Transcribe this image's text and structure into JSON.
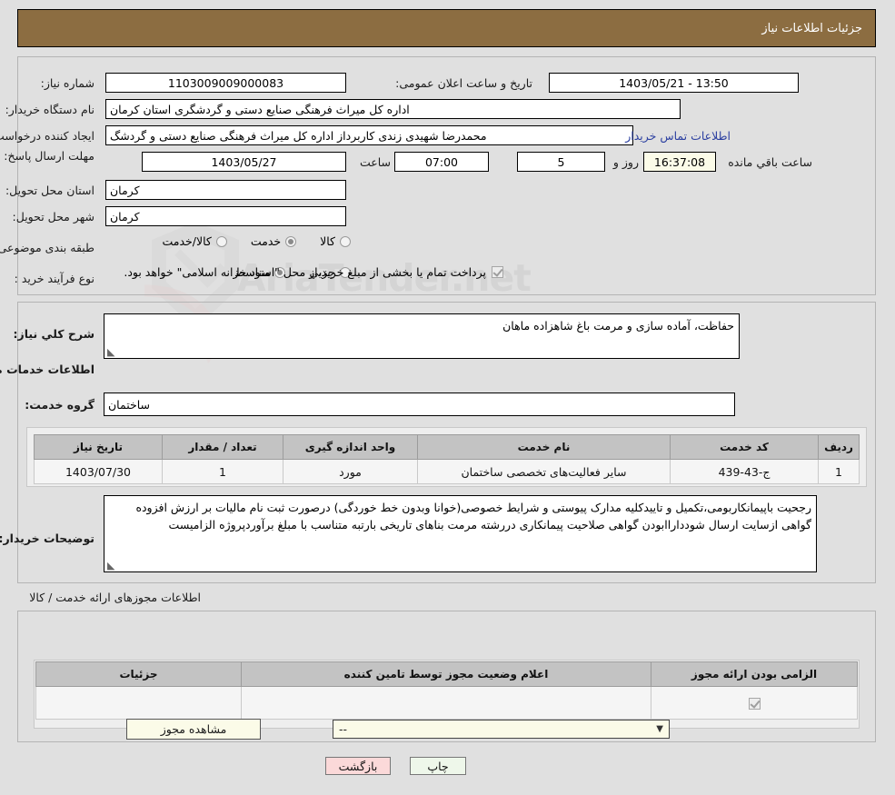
{
  "header": {
    "title": "جزئیات اطلاعات نیاز"
  },
  "top_form": {
    "need_number_label": "شماره نیاز:",
    "need_number_value": "1103009009000083",
    "announce_datetime_label": "تاریخ و ساعت اعلان عمومی:",
    "announce_datetime_value": "1403/05/21 - 13:50",
    "buyer_org_label": "نام دستگاه خریدار:",
    "buyer_org_value": "اداره کل میراث فرهنگی  صنایع دستی و گردشگری استان کرمان",
    "requester_label": "ایجاد کننده درخواست:",
    "requester_value": "محمدرضا شهیدی زندی کاربرداز اداره کل میراث فرهنگی  صنایع دستی و گردشگ",
    "contact_link": "اطلاعات تماس خریدار",
    "deadline_label": "مهلت ارسال پاسخ: تا تاریخ:",
    "deadline_date": "1403/05/27",
    "deadline_hour_label": "ساعت",
    "deadline_hour_value": "07:00",
    "remaining_days_value": "5",
    "remaining_days_label": "روز و",
    "remaining_time_value": "16:37:08",
    "remaining_time_label": "ساعت باقي مانده",
    "province_label": "استان محل تحویل:",
    "province_value": "کرمان",
    "city_label": "شهر محل تحویل:",
    "city_value": "کرمان",
    "category_label": "طبقه بندی موضوعی:",
    "category_options": [
      {
        "label": "کالا",
        "selected": false
      },
      {
        "label": "خدمت",
        "selected": true
      },
      {
        "label": "کالا/خدمت",
        "selected": false
      }
    ],
    "process_label": "نوع فرآیند خرید :",
    "process_options": [
      {
        "label": "جزیي",
        "selected": false
      },
      {
        "label": "متوسط",
        "selected": true
      }
    ],
    "treasury_checkbox_checked": true,
    "treasury_note": "پرداخت تمام یا بخشی از مبلغ خرید،از محل \"اسناد خزانه اسلامی\" خواهد بود."
  },
  "need_desc": {
    "label": "شرح كلي نیاز:",
    "value": "حفاظت، آماده سازی و مرمت باغ شاهزاده ماهان"
  },
  "services_section": {
    "title": "اطلاعات خدمات مورد نیاز",
    "group_label": "گروه خدمت:",
    "group_value": "ساختمان",
    "columns": [
      "ردیف",
      "کد خدمت",
      "نام خدمت",
      "واحد اندازه گیری",
      "تعداد / مقدار",
      "تاریخ نیاز"
    ],
    "rows": [
      {
        "row": "1",
        "service_code": "ج-43-439",
        "service_name": "سایر فعالیت‌های تخصصی ساختمان",
        "unit": "مورد",
        "quantity": "1",
        "need_date": "1403/07/30"
      }
    ]
  },
  "buyer_notes": {
    "label": "توضیحات خریدار:",
    "value": "رجحیت باپیمانکاربومی،تکمیل و تاییدکلیه مدارک پیوستی و شرایط خصوصی(خوانا وبدون خط خوردگی) درصورت ثبت نام مالیات بر ارزش افزوده گواهی ازسایت ارسال شودداراابودن گواهی صلاحیت پیمانکاری دررشته مرمت بناهای تاریخی بارتبه متناسب با مبلغ برآوردپروژه الزامیست"
  },
  "permits_section": {
    "title": "اطلاعات مجوزهای ارائه خدمت / کالا",
    "columns": [
      "الزامی بودن ارائه مجوز",
      "اعلام وضعیت مجوز توسط تامین کننده",
      "جزئیات"
    ],
    "rows": [
      {
        "required_checked": true,
        "status_value": "--",
        "details_button": "مشاهده مجوز"
      }
    ]
  },
  "footer": {
    "print_label": "چاپ",
    "back_label": "بازگشت"
  },
  "watermark": {
    "text": "AriaTender.net"
  },
  "colors": {
    "header_brown": "#8c6d41",
    "page_bg": "#e0e0e0",
    "link_blue": "#2b3fa0",
    "table_header_gray": "#c3c3c3",
    "cream_field": "#fbfbe8",
    "print_green": "#eef7ea",
    "back_pink": "#fbd9d9"
  }
}
